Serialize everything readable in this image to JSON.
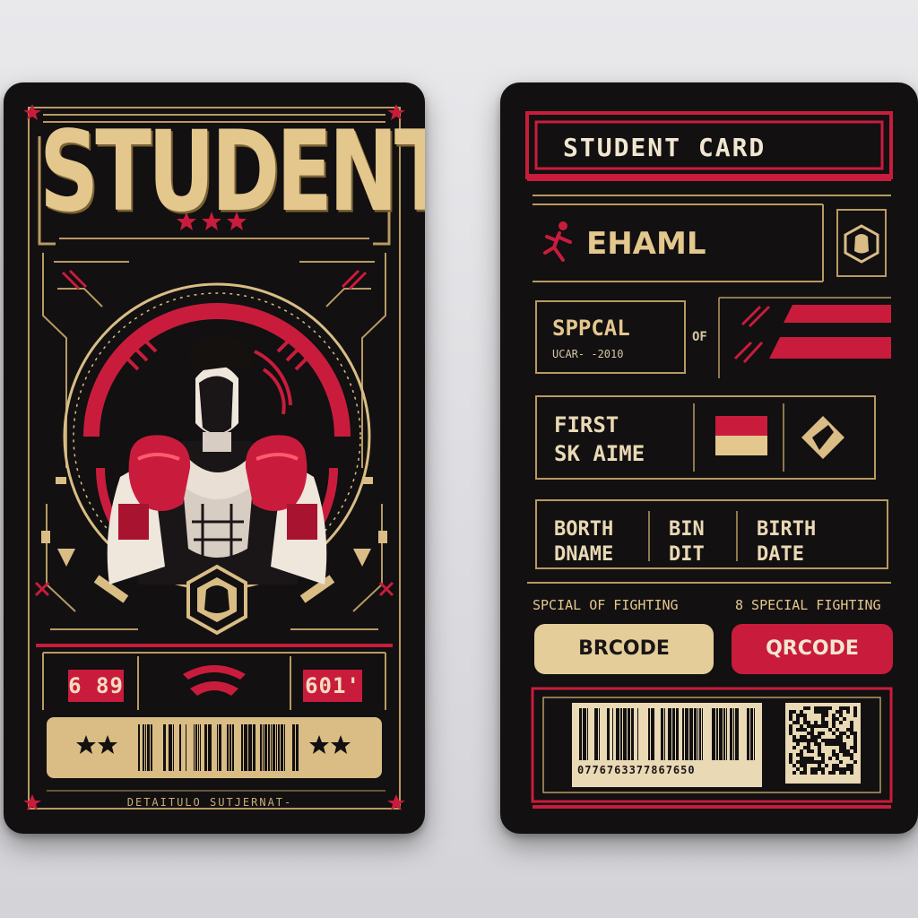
{
  "front": {
    "title": "STUDENT",
    "badge_left": "6 89",
    "badge_right": "601'",
    "footer": "DETAITULO SUTJERNAT-"
  },
  "back": {
    "header": "STUDENT CARD",
    "name": "EHAML",
    "special_title": "SPPCAL",
    "special_sub": "UCAR- -2010",
    "of_label": "OF",
    "first_line1": "FIRST",
    "first_line2": "SK AIME",
    "col1_line1": "BORTH",
    "col1_line2": "DNAME",
    "col2_line1": "BIN",
    "col2_line2": "DIT",
    "col3_line1": "BIRTH",
    "col3_line2": "DATE",
    "caption_left": "SPCIAL OF FIGHTING",
    "caption_right": "8 SPECIAL FIGHTING",
    "barcode_button": "BRCODE",
    "qrcode_button": "QRCODE",
    "barcode_number": "0776763377867650"
  },
  "colors": {
    "card": "#121011",
    "gold": "#d9bd85",
    "red": "#c91c3c",
    "cream": "#e9d9b4"
  },
  "icons": {
    "fighter": "boxer-illustration-icon",
    "emblem": "fist-emblem-icon",
    "runner": "runner-icon"
  }
}
